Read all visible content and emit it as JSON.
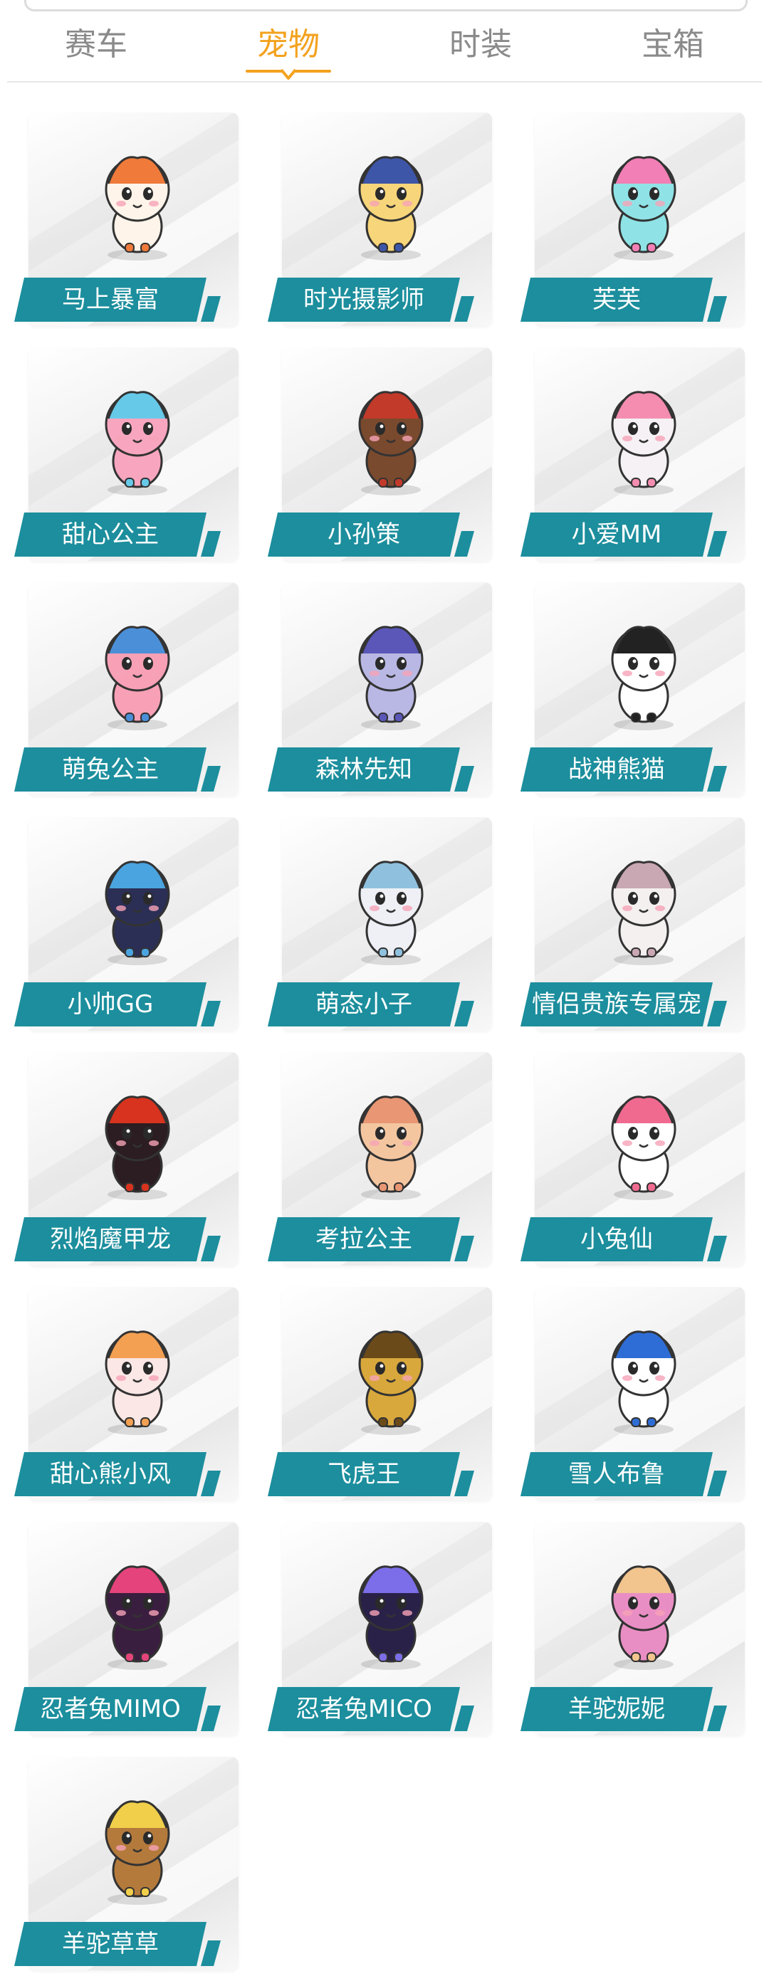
{
  "tabs": [
    {
      "label": "赛车",
      "active": false
    },
    {
      "label": "宠物",
      "active": true
    },
    {
      "label": "时装",
      "active": false
    },
    {
      "label": "宝箱",
      "active": false
    }
  ],
  "colors": {
    "accent": "#f3a21e",
    "tab_inactive": "#8a8a8a",
    "label_bg": "#1c8e9d",
    "label_text": "#ffffff"
  },
  "pets": [
    {
      "name": "马上暴富",
      "icon": "pony-pet-icon",
      "body": "#fff4ea",
      "accent": "#f07a3a"
    },
    {
      "name": "时光摄影师",
      "icon": "photographer-pet-icon",
      "body": "#f7d57a",
      "accent": "#3e56a8"
    },
    {
      "name": "芙芙",
      "icon": "fufu-pet-icon",
      "body": "#8fe3e6",
      "accent": "#f27fb5"
    },
    {
      "name": "甜心公主",
      "icon": "sweetheart-princess-pet-icon",
      "body": "#f8a6c0",
      "accent": "#67c9e8"
    },
    {
      "name": "小孙策",
      "icon": "xiao-sunce-pet-icon",
      "body": "#7a4a2e",
      "accent": "#c23a2a"
    },
    {
      "name": "小爱MM",
      "icon": "bear-girl-pet-icon",
      "body": "#f5f1f4",
      "accent": "#f48db0"
    },
    {
      "name": "萌兔公主",
      "icon": "bunny-princess-pet-icon",
      "body": "#f8a0b6",
      "accent": "#4b8fd8"
    },
    {
      "name": "森林先知",
      "icon": "forest-prophet-pet-icon",
      "body": "#b9b8e4",
      "accent": "#5a57b8"
    },
    {
      "name": "战神熊猫",
      "icon": "war-panda-pet-icon",
      "body": "#ffffff",
      "accent": "#222222"
    },
    {
      "name": "小帅GG",
      "icon": "handsome-boy-pet-icon",
      "body": "#2b2f55",
      "accent": "#4aa4e0"
    },
    {
      "name": "萌态小子",
      "icon": "sleepy-kid-pet-icon",
      "body": "#eef0f6",
      "accent": "#8fc1de"
    },
    {
      "name": "情侣贵族专属宠",
      "icon": "couple-noble-pet-icon",
      "body": "#f4f0f0",
      "accent": "#c9a7b3"
    },
    {
      "name": "烈焰魔甲龙",
      "icon": "flame-dragon-pet-icon",
      "body": "#2b1d22",
      "accent": "#d8331e"
    },
    {
      "name": "考拉公主",
      "icon": "koala-princess-pet-icon",
      "body": "#f4c6a0",
      "accent": "#e89673"
    },
    {
      "name": "小兔仙",
      "icon": "bunny-fairy-pet-icon",
      "body": "#ffffff",
      "accent": "#f06a90"
    },
    {
      "name": "甜心熊小风",
      "icon": "sweet-bear-pet-icon",
      "body": "#fbe7e5",
      "accent": "#f3a052"
    },
    {
      "name": "飞虎王",
      "icon": "flying-tiger-pet-icon",
      "body": "#d9a83c",
      "accent": "#6b4a1a"
    },
    {
      "name": "雪人布鲁",
      "icon": "snowman-pet-icon",
      "body": "#ffffff",
      "accent": "#2f6dd6"
    },
    {
      "name": "忍者兔MIMO",
      "icon": "ninja-bunny-mimo-pet-icon",
      "body": "#3a1e3f",
      "accent": "#e4447b"
    },
    {
      "name": "忍者兔MICO",
      "icon": "ninja-bunny-mico-pet-icon",
      "body": "#2a2148",
      "accent": "#7c6ee8"
    },
    {
      "name": "羊驼妮妮",
      "icon": "alpaca-nini-pet-icon",
      "body": "#e98ec4",
      "accent": "#f2c48e"
    },
    {
      "name": "羊驼草草",
      "icon": "alpaca-caocao-pet-icon",
      "body": "#b47a3c",
      "accent": "#f1cf4b"
    }
  ]
}
